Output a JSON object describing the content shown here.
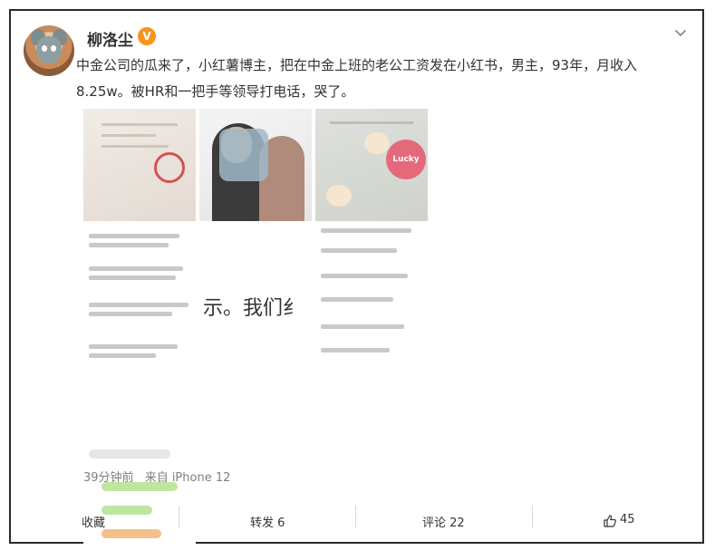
{
  "post": {
    "author": "柳洛尘",
    "verified_badge": "V",
    "text": "中金公司的瓜来了，小红薯博主，把在中金上班的老公工资发在小红书，男主，93年，月收入8.25w。被HR和一把手等领导打电话，哭了。",
    "time": "39分钟前",
    "source": "来自 iPhone 12",
    "images": {
      "sticker_text": "Lucky",
      "screenshot_text": "示。我们纟"
    }
  },
  "actions": {
    "favorite": "收藏",
    "repost": "转发 6",
    "comment": "评论 22",
    "like": "45"
  },
  "icons": {
    "more": "chevron-down-icon",
    "like": "thumb-up-icon"
  },
  "colors": {
    "accent": "#f7931e",
    "stamp": "#d05454",
    "sticker": "#e46a7b"
  }
}
